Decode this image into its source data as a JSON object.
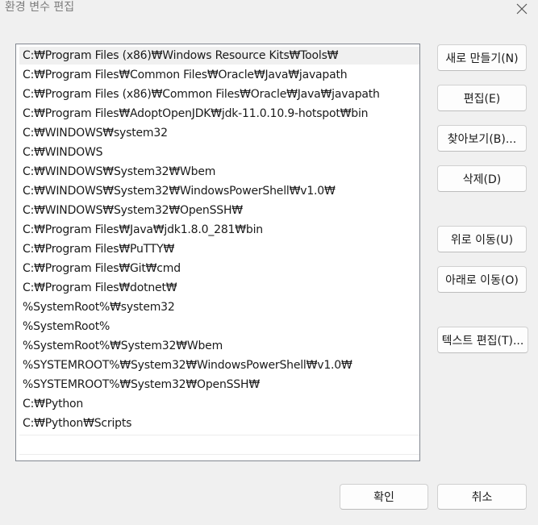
{
  "window": {
    "title": "환경 변수 편집"
  },
  "path_list": {
    "items": [
      "C:₩Program Files (x86)₩Windows Resource Kits₩Tools₩",
      "C:₩Program Files₩Common Files₩Oracle₩Java₩javapath",
      "C:₩Program Files (x86)₩Common Files₩Oracle₩Java₩javapath",
      "C:₩Program Files₩AdoptOpenJDK₩jdk-11.0.10.9-hotspot₩bin",
      "C:₩WINDOWS₩system32",
      "C:₩WINDOWS",
      "C:₩WINDOWS₩System32₩Wbem",
      "C:₩WINDOWS₩System32₩WindowsPowerShell₩v1.0₩",
      "C:₩WINDOWS₩System32₩OpenSSH₩",
      "C:₩Program Files₩Java₩jdk1.8.0_281₩bin",
      "C:₩Program Files₩PuTTY₩",
      "C:₩Program Files₩Git₩cmd",
      "C:₩Program Files₩dotnet₩",
      "%SystemRoot%₩system32",
      "%SystemRoot%",
      "%SystemRoot%₩System32₩Wbem",
      "%SYSTEMROOT%₩System32₩WindowsPowerShell₩v1.0₩",
      "%SYSTEMROOT%₩System32₩OpenSSH₩",
      "C:₩Python",
      "C:₩Python₩Scripts"
    ]
  },
  "buttons": {
    "new": "새로 만들기(N)",
    "edit": "편집(E)",
    "browse": "찾아보기(B)...",
    "delete": "삭제(D)",
    "move_up": "위로 이동(U)",
    "move_down": "아래로 이동(O)",
    "edit_text": "텍스트 편집(T)...",
    "ok": "확인",
    "cancel": "취소"
  }
}
